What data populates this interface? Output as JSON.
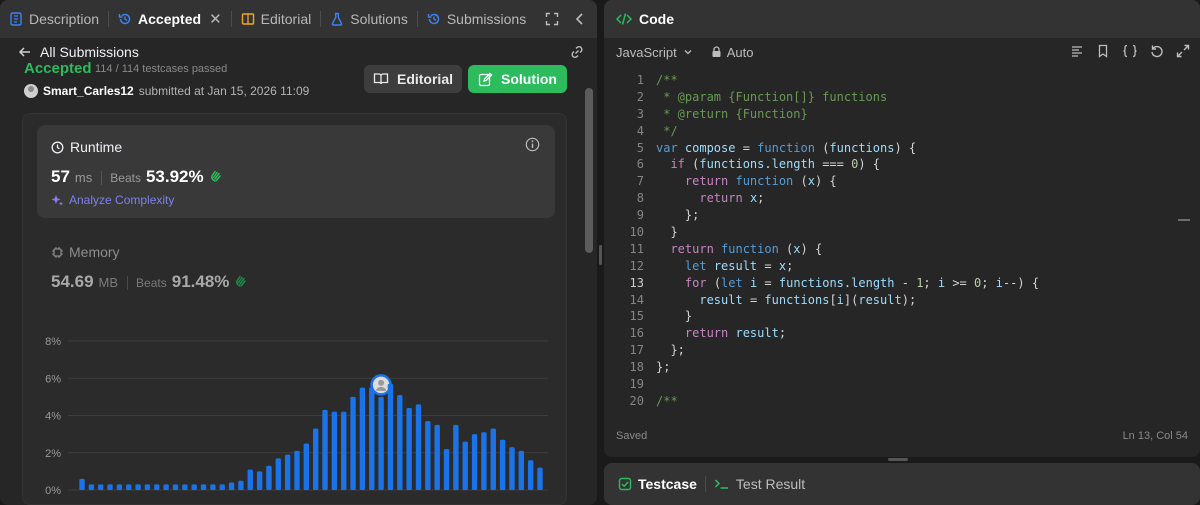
{
  "left_tabs": [
    {
      "label": "Description",
      "icon": "description-icon"
    },
    {
      "label": "Accepted",
      "icon": "history-icon",
      "active": true
    },
    {
      "label": "Editorial",
      "icon": "book-icon"
    },
    {
      "label": "Solutions",
      "icon": "flask-icon"
    },
    {
      "label": "Submissions",
      "icon": "history-icon"
    }
  ],
  "nav": {
    "back_label": "All Submissions"
  },
  "submission": {
    "status": "Accepted",
    "testcases": "114 / 114 testcases passed",
    "user": "Smart_Carles12",
    "submitted_text": "submitted at Jan 15, 2026 11:09",
    "editorial_button": "Editorial",
    "solution_button": "Solution"
  },
  "runtime": {
    "title": "Runtime",
    "value": "57",
    "unit": "ms",
    "beats_label": "Beats",
    "beats_value": "53.92%",
    "analyze_label": "Analyze Complexity"
  },
  "memory": {
    "title": "Memory",
    "value": "54.69",
    "unit": "MB",
    "beats_label": "Beats",
    "beats_value": "91.48%"
  },
  "chart_data": {
    "type": "bar",
    "ytick_labels": [
      "8%",
      "6%",
      "4%",
      "2%",
      "0%"
    ],
    "yticks": [
      8,
      6,
      4,
      2,
      0
    ],
    "ylim": [
      0,
      8
    ],
    "values": [
      0.6,
      0.3,
      0.3,
      0.3,
      0.3,
      0.3,
      0.3,
      0.3,
      0.3,
      0.3,
      0.3,
      0.3,
      0.3,
      0.3,
      0.3,
      0.3,
      0.4,
      0.5,
      1.1,
      1.0,
      1.3,
      1.7,
      1.9,
      2.1,
      2.5,
      3.3,
      4.3,
      4.2,
      4.2,
      5.0,
      5.5,
      5.5,
      5.0,
      5.7,
      5.1,
      4.4,
      4.6,
      3.7,
      3.5,
      2.2,
      3.5,
      2.6,
      3.0,
      3.1,
      3.3,
      2.7,
      2.3,
      2.1,
      1.6,
      1.2
    ],
    "highlight_index": 32,
    "color": "#1a73e8",
    "grid": true
  },
  "code_panel": {
    "title": "Code",
    "language": "JavaScript",
    "mode": "Auto",
    "status_left": "Saved",
    "status_right": "Ln 13, Col 54",
    "current_line": 13,
    "lines": [
      [
        {
          "t": "/**",
          "c": "c-com"
        }
      ],
      [
        {
          "t": " * @param {Function[]} functions",
          "c": "c-com"
        }
      ],
      [
        {
          "t": " * @return {Function}",
          "c": "c-com"
        }
      ],
      [
        {
          "t": " */",
          "c": "c-com"
        }
      ],
      [
        {
          "t": "var ",
          "c": "c-kw"
        },
        {
          "t": "compose",
          "c": "c-var"
        },
        {
          "t": " = ",
          "c": ""
        },
        {
          "t": "function",
          "c": "c-kw"
        },
        {
          "t": " (",
          "c": ""
        },
        {
          "t": "functions",
          "c": "c-var"
        },
        {
          "t": ") {",
          "c": ""
        }
      ],
      [
        {
          "t": "  "
        },
        {
          "t": "if",
          "c": "c-ctl"
        },
        {
          "t": " (",
          "c": ""
        },
        {
          "t": "functions",
          "c": "c-var"
        },
        {
          "t": ".",
          "c": ""
        },
        {
          "t": "length",
          "c": "c-var"
        },
        {
          "t": " === ",
          "c": ""
        },
        {
          "t": "0",
          "c": "c-num"
        },
        {
          "t": ") {",
          "c": ""
        }
      ],
      [
        {
          "t": "    "
        },
        {
          "t": "return ",
          "c": "c-ctl"
        },
        {
          "t": "function",
          "c": "c-kw"
        },
        {
          "t": " (",
          "c": ""
        },
        {
          "t": "x",
          "c": "c-var"
        },
        {
          "t": ") {",
          "c": ""
        }
      ],
      [
        {
          "t": "      "
        },
        {
          "t": "return ",
          "c": "c-ctl"
        },
        {
          "t": "x",
          "c": "c-var"
        },
        {
          "t": ";",
          "c": ""
        }
      ],
      [
        {
          "t": "    };",
          "c": ""
        }
      ],
      [
        {
          "t": "  }",
          "c": ""
        }
      ],
      [
        {
          "t": "  "
        },
        {
          "t": "return ",
          "c": "c-ctl"
        },
        {
          "t": "function",
          "c": "c-kw"
        },
        {
          "t": " (",
          "c": ""
        },
        {
          "t": "x",
          "c": "c-var"
        },
        {
          "t": ") {",
          "c": ""
        }
      ],
      [
        {
          "t": "    "
        },
        {
          "t": "let ",
          "c": "c-kw"
        },
        {
          "t": "result",
          "c": "c-var"
        },
        {
          "t": " = ",
          "c": ""
        },
        {
          "t": "x",
          "c": "c-var"
        },
        {
          "t": ";",
          "c": ""
        }
      ],
      [
        {
          "t": "    "
        },
        {
          "t": "for",
          "c": "c-ctl"
        },
        {
          "t": " (",
          "c": ""
        },
        {
          "t": "let ",
          "c": "c-kw"
        },
        {
          "t": "i",
          "c": "c-var"
        },
        {
          "t": " = ",
          "c": ""
        },
        {
          "t": "functions",
          "c": "c-var"
        },
        {
          "t": ".",
          "c": ""
        },
        {
          "t": "length",
          "c": "c-var"
        },
        {
          "t": " - ",
          "c": ""
        },
        {
          "t": "1",
          "c": "c-num"
        },
        {
          "t": "; ",
          "c": ""
        },
        {
          "t": "i",
          "c": "c-var"
        },
        {
          "t": " >= ",
          "c": ""
        },
        {
          "t": "0",
          "c": "c-num"
        },
        {
          "t": "; ",
          "c": ""
        },
        {
          "t": "i",
          "c": "c-var"
        },
        {
          "t": "--) {",
          "c": ""
        }
      ],
      [
        {
          "t": "      "
        },
        {
          "t": "result",
          "c": "c-var"
        },
        {
          "t": " = ",
          "c": ""
        },
        {
          "t": "functions",
          "c": "c-var"
        },
        {
          "t": "[",
          "c": ""
        },
        {
          "t": "i",
          "c": "c-var"
        },
        {
          "t": "](",
          "c": ""
        },
        {
          "t": "result",
          "c": "c-var"
        },
        {
          "t": ");",
          "c": ""
        }
      ],
      [
        {
          "t": "    }",
          "c": ""
        }
      ],
      [
        {
          "t": "    "
        },
        {
          "t": "return ",
          "c": "c-ctl"
        },
        {
          "t": "result",
          "c": "c-var"
        },
        {
          "t": ";",
          "c": ""
        }
      ],
      [
        {
          "t": "  };",
          "c": ""
        }
      ],
      [
        {
          "t": "};",
          "c": ""
        }
      ],
      [
        {
          "t": "",
          "c": ""
        }
      ],
      [
        {
          "t": "/**",
          "c": "c-com"
        }
      ]
    ]
  },
  "bottom_tabs": [
    {
      "label": "Testcase",
      "icon": "checkbox-icon",
      "active": true
    },
    {
      "label": "Test Result",
      "icon": "terminal-icon"
    }
  ]
}
